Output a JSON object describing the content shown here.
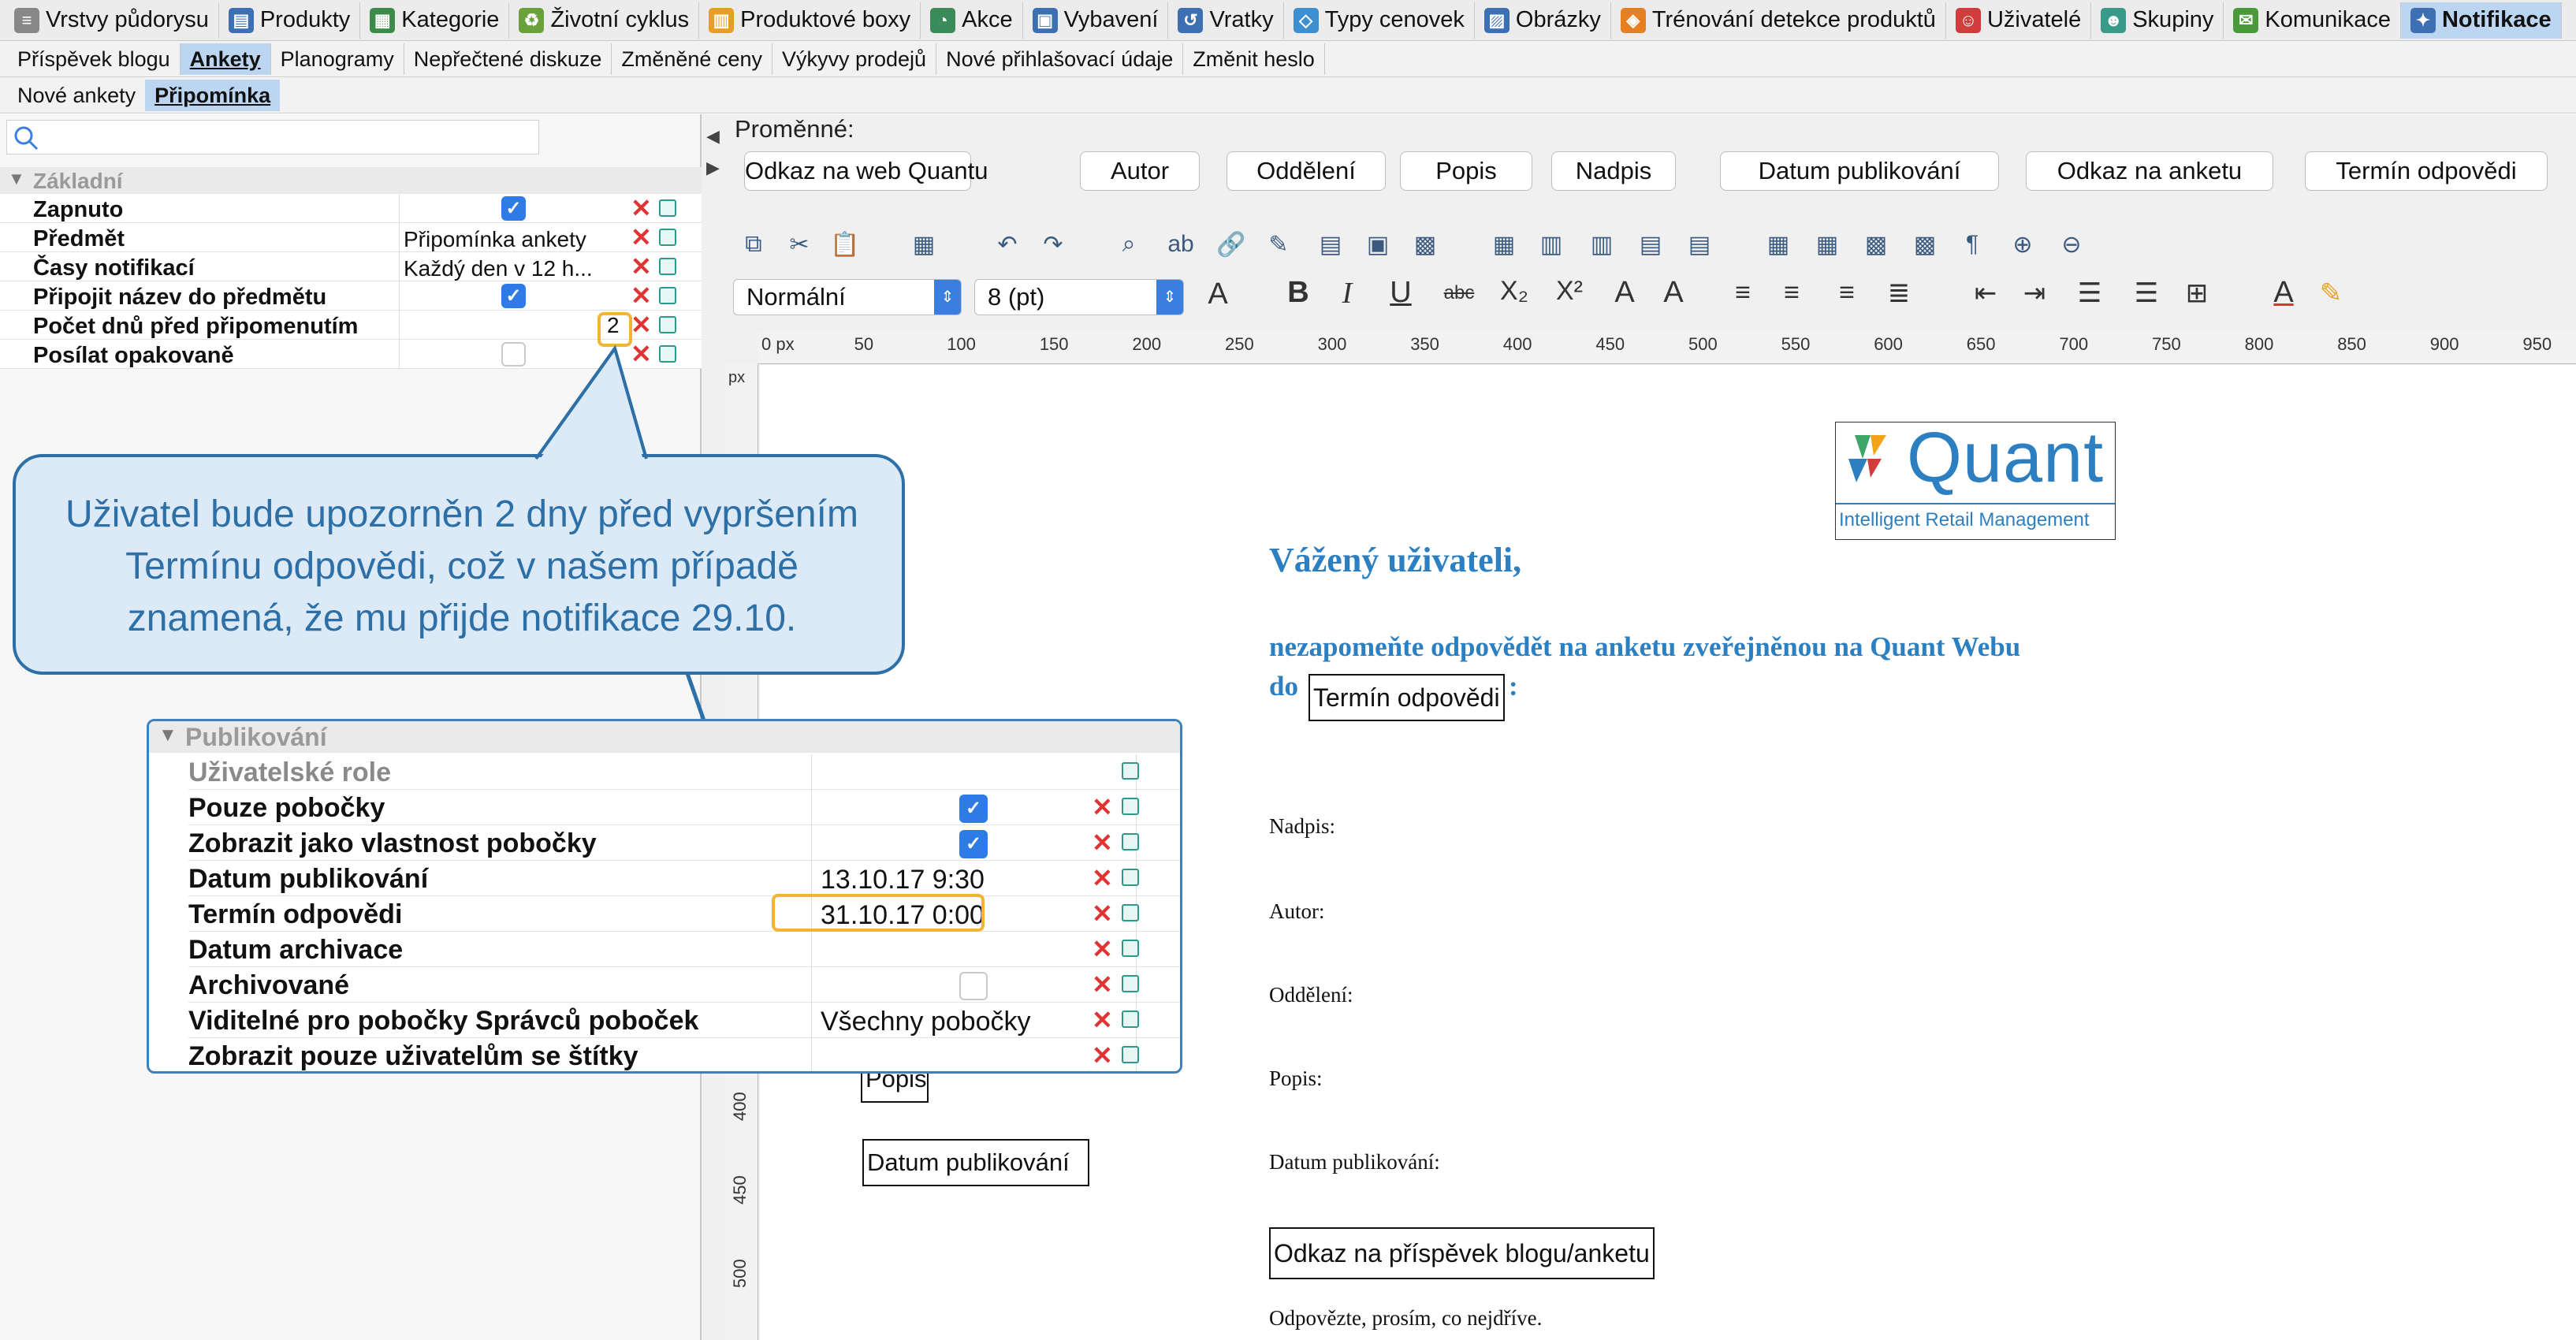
{
  "modules": [
    {
      "label": "Vrstvy půdorysu",
      "icon": "layers-icon",
      "color": "#888888"
    },
    {
      "label": "Produkty",
      "icon": "product-icon",
      "color": "#3d6fb3"
    },
    {
      "label": "Kategorie",
      "icon": "category-icon",
      "color": "#3d8b4a"
    },
    {
      "label": "Životní cyklus",
      "icon": "lifecycle-icon",
      "color": "#6aa13a"
    },
    {
      "label": "Produktové boxy",
      "icon": "product-box-icon",
      "color": "#e6a020"
    },
    {
      "label": "Akce",
      "icon": "action-icon",
      "color": "#3a8a5a"
    },
    {
      "label": "Vybavení",
      "icon": "equipment-icon",
      "color": "#3d6fb3"
    },
    {
      "label": "Vratky",
      "icon": "returns-icon",
      "color": "#3d6fb3"
    },
    {
      "label": "Typy cenovek",
      "icon": "price-tag-icon",
      "color": "#3d8fd0"
    },
    {
      "label": "Obrázky",
      "icon": "image-icon",
      "color": "#3d6fb3"
    },
    {
      "label": "Trénování detekce produktů",
      "icon": "training-icon",
      "color": "#e67e22"
    },
    {
      "label": "Uživatelé",
      "icon": "user-icon",
      "color": "#d23c3c"
    },
    {
      "label": "Skupiny",
      "icon": "group-icon",
      "color": "#3a9a8a"
    },
    {
      "label": "Komunikace",
      "icon": "mail-icon",
      "color": "#4a9a3a"
    },
    {
      "label": "Notifikace",
      "icon": "notification-icon",
      "color": "#3d6fb3",
      "active": true
    }
  ],
  "subtabs": [
    "Příspěvek blogu",
    "Ankety",
    "Planogramy",
    "Nepřečtené diskuze",
    "Změněné ceny",
    "Výkyvy prodejů",
    "Nové přihlašovací údaje",
    "Změnit heslo"
  ],
  "subtabs_active": "Ankety",
  "subtabs2": [
    "Nové ankety",
    "Připomínka"
  ],
  "subtabs2_active": "Připomínka",
  "left": {
    "group": "Základní",
    "rows": [
      {
        "label": "Zapnuto",
        "type": "checkbox",
        "checked": true
      },
      {
        "label": "Předmět",
        "value": "Připomínka ankety"
      },
      {
        "label": "Časy notifikací",
        "value": "Každý den v 12 h..."
      },
      {
        "label": "Připojit název do předmětu",
        "type": "checkbox",
        "checked": true
      },
      {
        "label": "Počet dnů před připomenutím",
        "value": "2"
      },
      {
        "label": "Posílat opakovaně",
        "type": "checkbox",
        "checked": false
      }
    ]
  },
  "callout": "Uživatel bude upozorněn 2 dny před vypršením Termínu odpovědi, což v našem případě znamená, že mu přijde notifikace 29.10.",
  "publish": {
    "group": "Publikování",
    "rows": [
      {
        "label": "Uživatelské role",
        "value": "",
        "disabled": true
      },
      {
        "label": "Pouze pobočky",
        "type": "checkbox",
        "checked": true
      },
      {
        "label": "Zobrazit jako vlastnost pobočky",
        "type": "checkbox",
        "checked": true
      },
      {
        "label": "Datum publikování",
        "value": "13.10.17 9:30"
      },
      {
        "label": "Termín odpovědi",
        "value": "31.10.17 0:00"
      },
      {
        "label": "Datum archivace",
        "value": ""
      },
      {
        "label": "Archivované",
        "type": "checkbox",
        "checked": false
      },
      {
        "label": "Viditelné pro pobočky Správců poboček",
        "value": "Všechny pobočky"
      },
      {
        "label": "Zobrazit pouze uživatelům se štítky",
        "value": ""
      }
    ]
  },
  "editor": {
    "variables_label": "Proměnné:",
    "variables": [
      "Odkaz na web Quantu",
      "Autor",
      "Oddělení",
      "Popis",
      "Nadpis",
      "Datum publikování",
      "Odkaz na anketu",
      "Termín odpovědi"
    ],
    "style_select": "Normální",
    "size_select": "8 (pt)",
    "ruler_unit": "px",
    "ruler_ticks": [
      "0 px",
      "50",
      "100",
      "150",
      "200",
      "250",
      "300",
      "350",
      "400",
      "450",
      "500",
      "550",
      "600",
      "650",
      "700",
      "750",
      "800",
      "850",
      "900",
      "950"
    ],
    "vruler_ticks": [
      "400",
      "450",
      "500"
    ]
  },
  "document": {
    "logo_text": "Quant",
    "logo_tagline": "Intelligent Retail Management",
    "greeting": "Vážený uživateli,",
    "line1": "nezapomeňte odpovědět na anketu zveřejněnou na Quant Webu",
    "line2_prefix": "do",
    "deadline_field": "Termín odpovědi",
    "line2_suffix": ":",
    "fields": [
      {
        "label": "Nadpis:",
        "field": "Nadpis"
      },
      {
        "label": "Autor:",
        "field": "Autor"
      },
      {
        "label": "Oddělení:",
        "field": "Oddělení"
      },
      {
        "label": "Popis:",
        "field": "Popis"
      },
      {
        "label": "Datum publikování:",
        "field": "Datum publikování"
      }
    ],
    "link_field": "Odkaz na příspěvek blogu/anketu",
    "closing": "Odpovězte, prosím, co nejdříve."
  },
  "colors": {
    "accent": "#2d6fa7",
    "highlight": "#f2b431",
    "heading": "#2c7fc1",
    "checkbox": "#2f7be6",
    "delete": "#e03333"
  }
}
